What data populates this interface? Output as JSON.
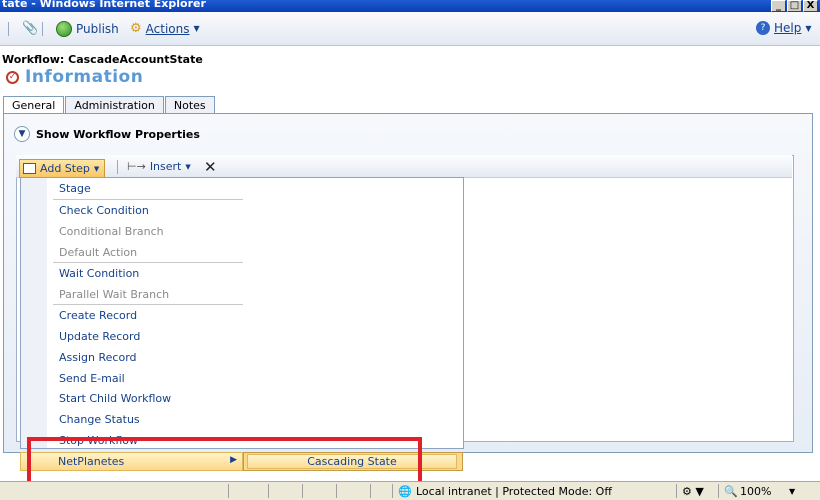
{
  "window": {
    "title": "tate - Windows Internet Explorer",
    "buttons": [
      "_",
      "□",
      "X"
    ]
  },
  "commandbar": {
    "publish_label": "Publish",
    "actions_label": "Actions",
    "help_label": "Help"
  },
  "header": {
    "workflow_name": "Workflow: CascadeAccountState",
    "info_title": "Information"
  },
  "tabs": [
    {
      "label": "General",
      "active": true
    },
    {
      "label": "Administration",
      "active": false
    },
    {
      "label": "Notes",
      "active": false
    }
  ],
  "properties_toggle": "Show Workflow Properties",
  "toolbar": {
    "add_step_label": "Add Step",
    "insert_label": "Insert"
  },
  "menu": {
    "items": [
      {
        "label": "Stage",
        "enabled": true
      },
      {
        "label": "Check Condition",
        "enabled": true
      },
      {
        "label": "Conditional Branch",
        "enabled": false
      },
      {
        "label": "Default Action",
        "enabled": false
      },
      {
        "label": "Wait Condition",
        "enabled": true
      },
      {
        "label": "Parallel Wait Branch",
        "enabled": false
      },
      {
        "label": "Create Record",
        "enabled": true
      },
      {
        "label": "Update Record",
        "enabled": true
      },
      {
        "label": "Assign Record",
        "enabled": true
      },
      {
        "label": "Send E-mail",
        "enabled": true
      },
      {
        "label": "Start Child Workflow",
        "enabled": true
      },
      {
        "label": "Change Status",
        "enabled": true
      },
      {
        "label": "Stop Workflow",
        "enabled": true
      },
      {
        "label": "NetPlanetes",
        "enabled": true,
        "has_submenu": true
      }
    ],
    "submenu_item": "Cascading State"
  },
  "statusbar": {
    "zone": "Local intranet | Protected Mode: Off",
    "zoom": "100%"
  },
  "colors": {
    "accent": "#15428b",
    "highlight_border": "#e0202a",
    "menu_hover": "#fbd98c"
  }
}
